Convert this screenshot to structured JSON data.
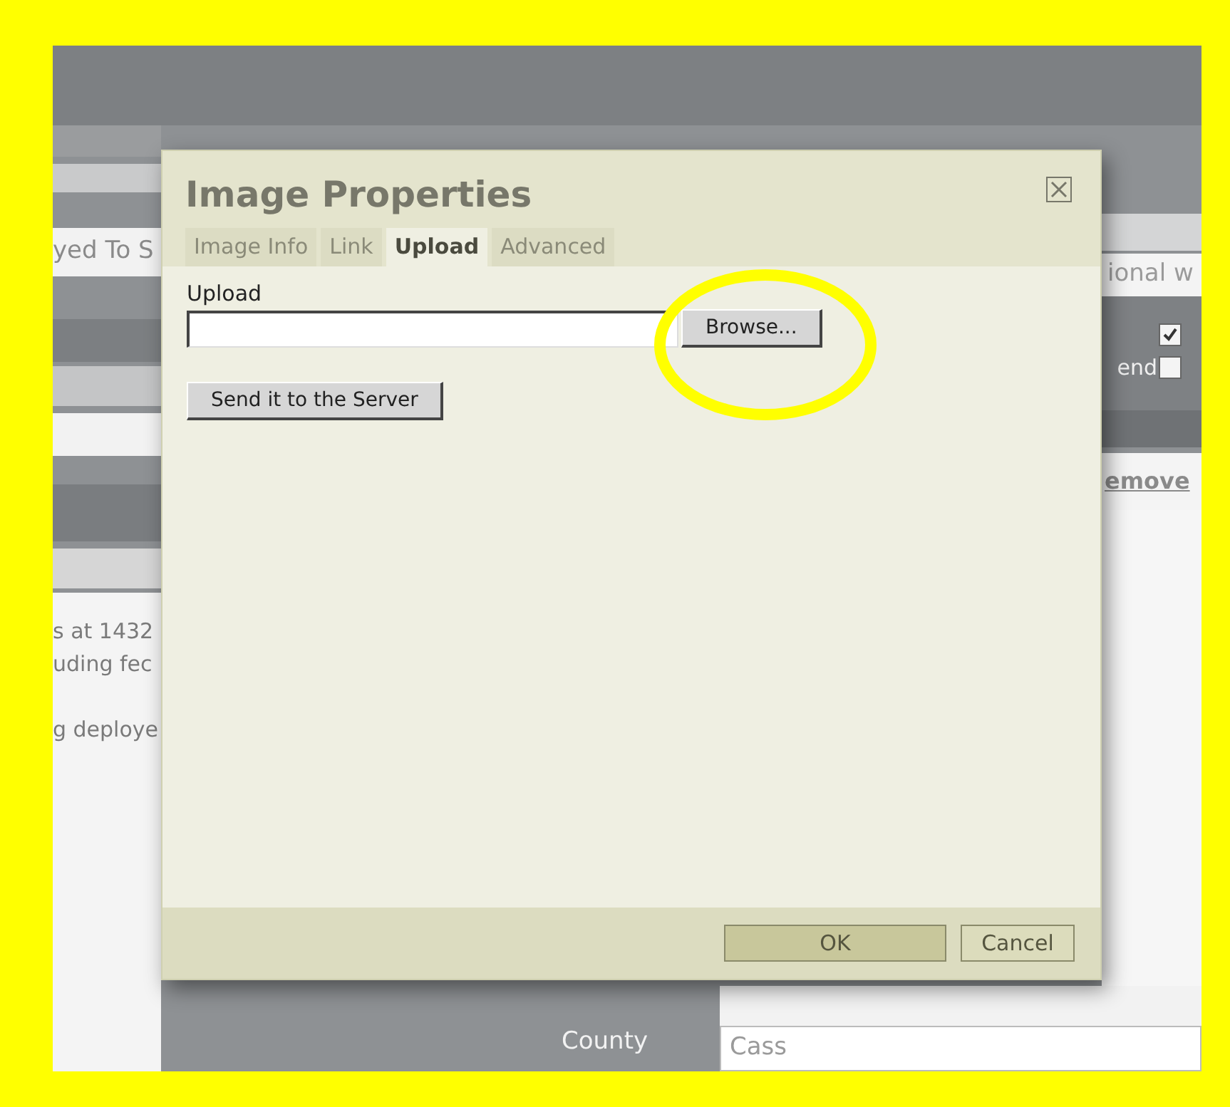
{
  "background_page": {
    "left_field": {
      "value": "yed To S"
    },
    "left_text_lines": [
      "s at 1432",
      "uding fec",
      "g deploye"
    ],
    "right_field": {
      "value": "ional w"
    },
    "right_checkboxes": [
      {
        "checked": true
      },
      {
        "prefix": "end",
        "checked": false
      }
    ],
    "right_link": "emove",
    "county_row": {
      "label": "County",
      "value": "Cass"
    }
  },
  "dialog": {
    "title": "Image Properties",
    "tabs": [
      {
        "label": "Image Info",
        "selected": false
      },
      {
        "label": "Link",
        "selected": false
      },
      {
        "label": "Upload",
        "selected": true
      },
      {
        "label": "Advanced",
        "selected": false
      }
    ],
    "upload_label": "Upload",
    "browse_button": "Browse...",
    "send_button": "Send it to the Server",
    "footer_buttons": [
      {
        "label": "OK",
        "kind": "primary"
      },
      {
        "label": "Cancel",
        "kind": "secondary"
      }
    ]
  }
}
